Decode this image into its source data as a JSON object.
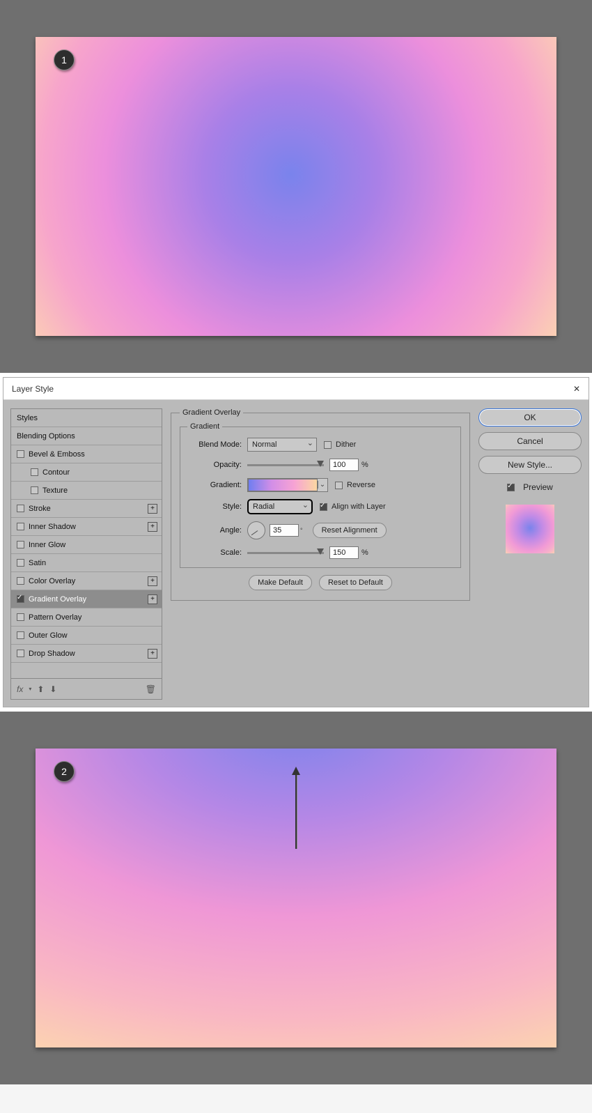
{
  "badge1": "1",
  "badge2": "2",
  "dialog": {
    "title": "Layer Style",
    "close": "✕",
    "effects": {
      "styles": "Styles",
      "blending": "Blending Options",
      "bevel": "Bevel & Emboss",
      "contour": "Contour",
      "texture": "Texture",
      "stroke": "Stroke",
      "inner_shadow": "Inner Shadow",
      "inner_glow": "Inner Glow",
      "satin": "Satin",
      "color_overlay": "Color Overlay",
      "gradient_overlay": "Gradient Overlay",
      "pattern_overlay": "Pattern Overlay",
      "outer_glow": "Outer Glow",
      "drop_shadow": "Drop Shadow"
    },
    "toolbar": {
      "fx": "fx"
    },
    "center": {
      "group_title": "Gradient Overlay",
      "inner_title": "Gradient",
      "blend_mode_label": "Blend Mode:",
      "blend_mode_value": "Normal",
      "dither": "Dither",
      "opacity_label": "Opacity:",
      "opacity_value": "100",
      "gradient_label": "Gradient:",
      "reverse": "Reverse",
      "style_label": "Style:",
      "style_value": "Radial",
      "align": "Align with Layer",
      "angle_label": "Angle:",
      "angle_value": "35",
      "reset_align": "Reset Alignment",
      "scale_label": "Scale:",
      "scale_value": "150",
      "make_default": "Make Default",
      "reset_default": "Reset to Default"
    },
    "right": {
      "ok": "OK",
      "cancel": "Cancel",
      "new_style": "New Style...",
      "preview": "Preview"
    }
  }
}
